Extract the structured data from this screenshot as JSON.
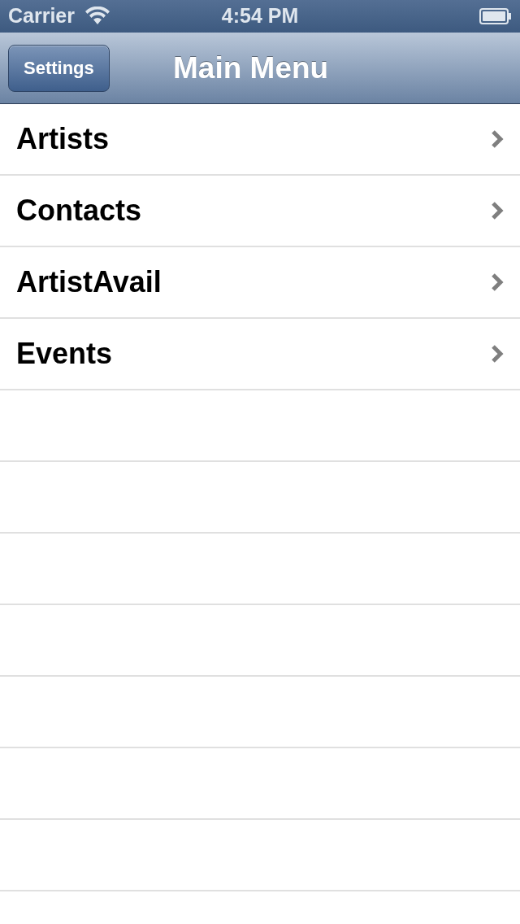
{
  "status_bar": {
    "carrier": "Carrier",
    "time": "4:54 PM"
  },
  "nav_bar": {
    "back_button": "Settings",
    "title": "Main Menu"
  },
  "menu_items": [
    {
      "label": "Artists"
    },
    {
      "label": "Contacts"
    },
    {
      "label": "ArtistAvail"
    },
    {
      "label": "Events"
    }
  ]
}
